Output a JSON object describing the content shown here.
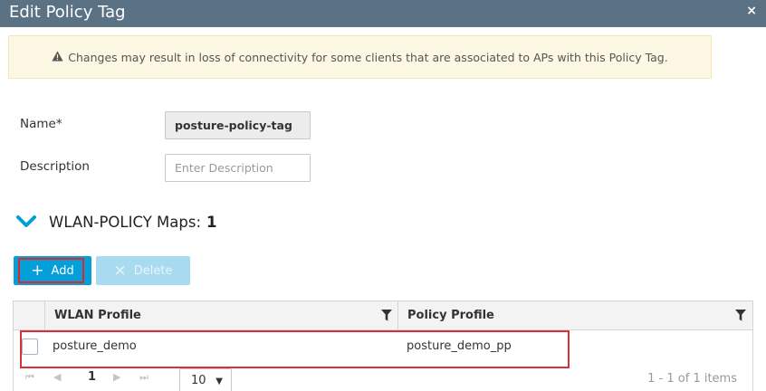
{
  "dialog": {
    "title": "Edit Policy Tag",
    "close_glyph": "×"
  },
  "warning": {
    "icon": "warning-triangle-icon",
    "glyph": "▲",
    "text": "Changes may result in loss of connectivity for some clients that are associated to APs with this Policy Tag."
  },
  "form": {
    "name_label": "Name*",
    "name_value": "posture-policy-tag",
    "description_label": "Description",
    "description_placeholder": "Enter Description"
  },
  "section": {
    "title": "WLAN-POLICY Maps:",
    "count": "1",
    "icon": "chevron-down-icon"
  },
  "toolbar": {
    "add_glyph": "+",
    "add_label": "Add",
    "delete_glyph": "×",
    "delete_label": "Delete"
  },
  "table": {
    "columns": [
      "WLAN Profile",
      "Policy Profile"
    ],
    "rows": [
      {
        "wlan_profile": "posture_demo",
        "policy_profile": "posture_demo_pp"
      }
    ]
  },
  "pager": {
    "first": "⏮",
    "prev": "◀",
    "current_page": "1",
    "next": "▶",
    "last": "⏭",
    "page_size": "10",
    "summary": "1 - 1 of 1 items"
  },
  "colors": {
    "titlebar": "#5b7184",
    "primary": "#049fd9",
    "highlight": "#d8313b",
    "warning_bg": "#fcf8e3"
  }
}
